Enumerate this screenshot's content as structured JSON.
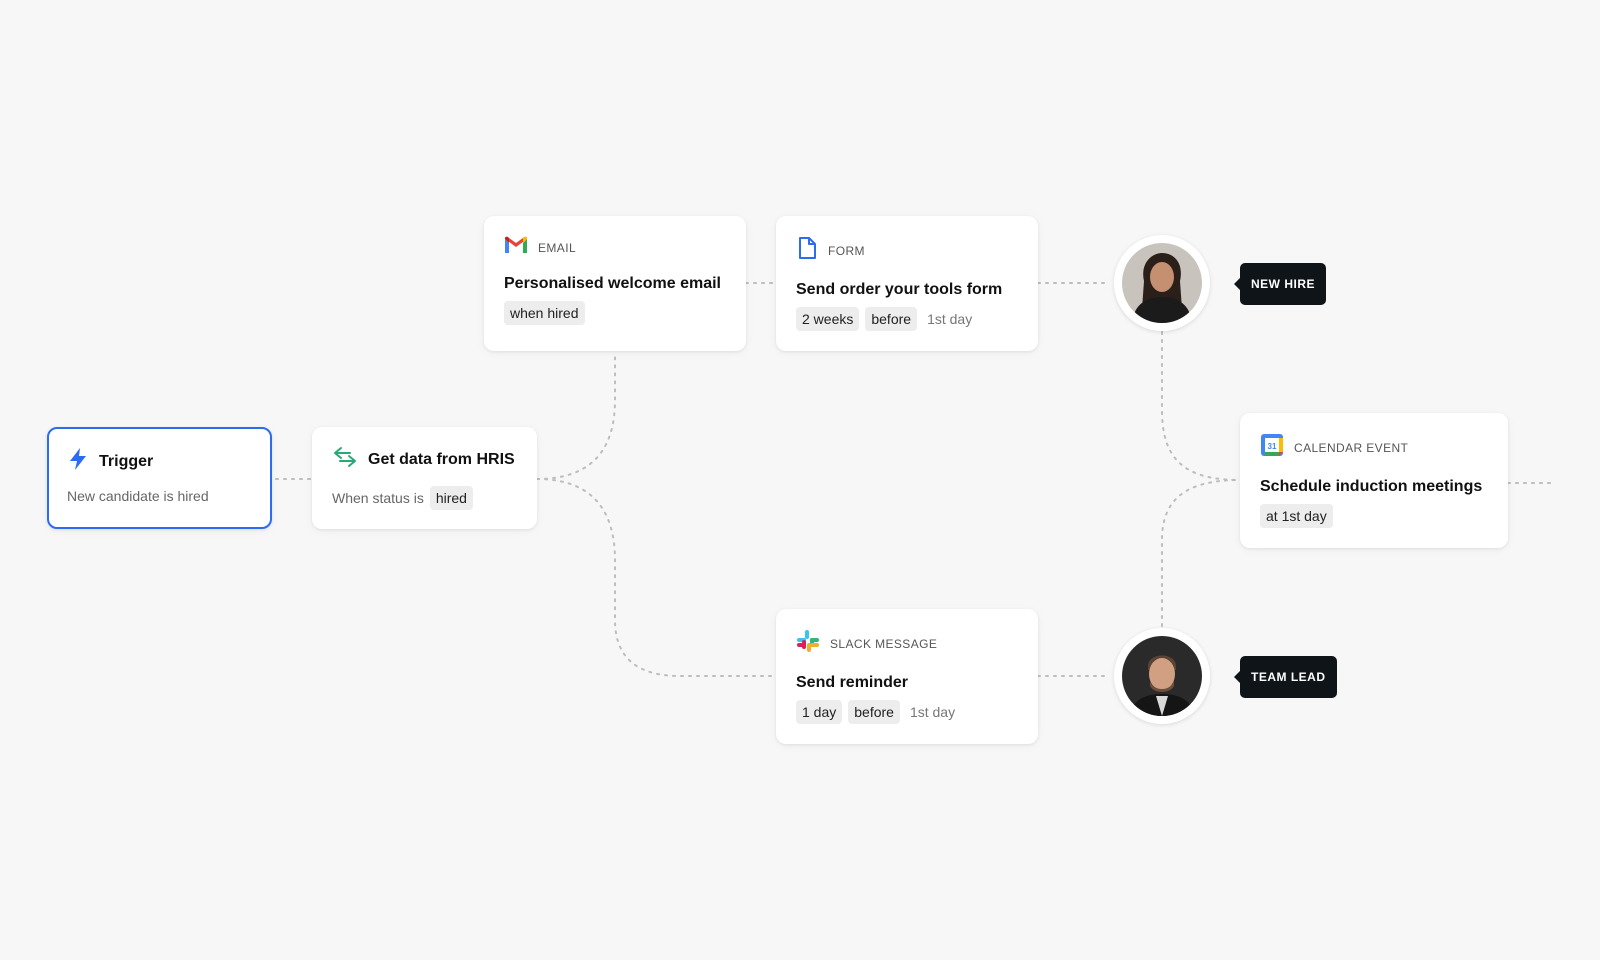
{
  "trigger": {
    "title": "Trigger",
    "subtitle": "New candidate is hired",
    "accent": "#2b6cf0"
  },
  "hris": {
    "title": "Get data from HRIS",
    "label": "When status is",
    "chip": "hired"
  },
  "email": {
    "kind": "EMAIL",
    "title": "Personalised welcome email",
    "chip": "when hired"
  },
  "form": {
    "kind": "FORM",
    "title": "Send order your tools form",
    "chips": [
      "2 weeks",
      "before"
    ],
    "suffix": "1st day"
  },
  "slack": {
    "kind": "SLACK MESSAGE",
    "title": "Send reminder",
    "chips": [
      "1 day",
      "before"
    ],
    "suffix": "1st day"
  },
  "calendar": {
    "kind": "CALENDAR EVENT",
    "title": "Schedule induction meetings",
    "chip": "at 1st day",
    "day": "31"
  },
  "new_hire": {
    "role": "NEW HIRE"
  },
  "team_lead": {
    "role": "TEAM LEAD"
  },
  "icons": {
    "trigger": "lightning-icon",
    "hris": "sync-arrows-icon",
    "email": "gmail-icon",
    "form": "document-icon",
    "slack": "slack-icon",
    "calendar": "google-calendar-icon"
  }
}
